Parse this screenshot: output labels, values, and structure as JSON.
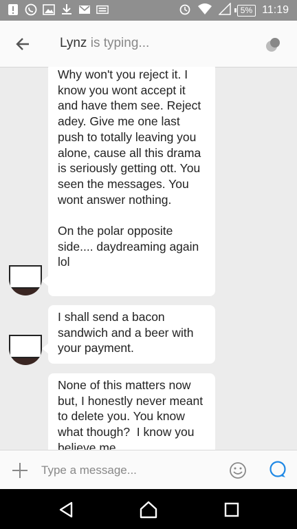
{
  "status_bar": {
    "time": "11:19",
    "battery": "5%",
    "icons": [
      "alert-icon",
      "whatsapp-icon",
      "image-icon",
      "download-icon",
      "gmail-icon",
      "keyboard-icon",
      "alarm-icon",
      "wifi-icon",
      "signal-icon",
      "battery-icon"
    ]
  },
  "header": {
    "contact_name": "Lynz",
    "status": " is typing...",
    "back_icon": "arrow-left-icon",
    "menu_icon": "hangouts-icon"
  },
  "messages": [
    {
      "text": "Why won't you reject it. I know you wont accept it and have them see. Reject adey. Give me one last push to totally leaving you alone, cause all this drama is seriously getting ott. You seen the messages. You wont answer nothing.\n\nOn the polar opposite side.... daydreaming again lol"
    },
    {
      "text": "I shall send a bacon sandwich and a beer with your payment."
    },
    {
      "text": "None of this matters now but, I honestly never meant to delete you. You know what though?  I know you believe me"
    }
  ],
  "composer": {
    "placeholder": "Type a message...",
    "icons": [
      "add-icon",
      "smiley-icon",
      "send-icon"
    ]
  },
  "nav_bar": {
    "icons": [
      "back-triangle-icon",
      "home-icon",
      "recents-icon"
    ]
  },
  "colors": {
    "status_bar": "#8f8f8f",
    "background": "#ececec",
    "accent": "#1e88e5"
  }
}
